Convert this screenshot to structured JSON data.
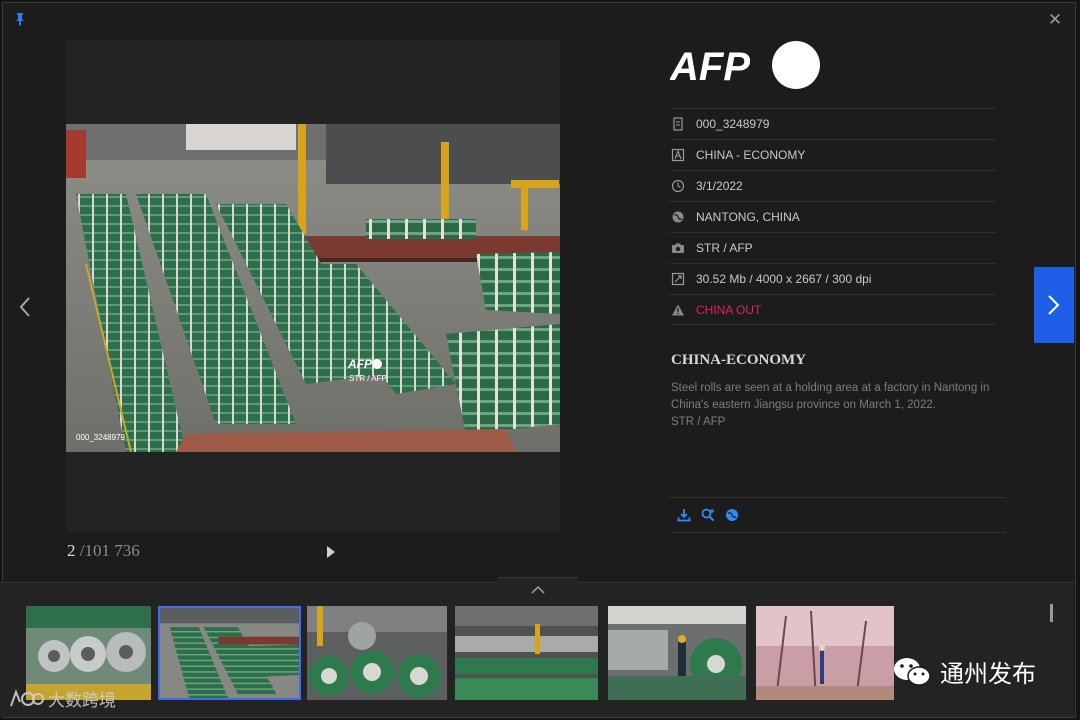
{
  "window": {
    "close_glyph": "✕"
  },
  "logo": {
    "text": "AFP"
  },
  "photo": {
    "id_label": "000_3248979",
    "wm_brand": "AFP",
    "wm_credit": "STR / AFP"
  },
  "counter": {
    "current": "2",
    "total": "/101 736"
  },
  "meta": {
    "rows": [
      {
        "icon": "document-icon",
        "text": "000_3248979"
      },
      {
        "icon": "category-icon",
        "text": "CHINA - ECONOMY"
      },
      {
        "icon": "clock-icon",
        "text": "3/1/2022"
      },
      {
        "icon": "globe-icon",
        "text": "NANTONG, CHINA"
      },
      {
        "icon": "camera-icon",
        "text": "STR / AFP"
      },
      {
        "icon": "resize-icon",
        "text": "30.52 Mb / 4000 x 2667 / 300 dpi"
      },
      {
        "icon": "warning-icon",
        "text": "CHINA OUT"
      }
    ]
  },
  "story": {
    "title": "CHINA-ECONOMY",
    "caption_1": "Steel rolls are seen at a holding area at a factory in Nantong in China's eastern Jiangsu province on March 1, 2022.",
    "caption_2": "STR / AFP"
  },
  "colors": {
    "accent": "#1f5fe8",
    "warning": "#e0245e",
    "selected_border": "#3d6df2"
  },
  "watermark": {
    "left_text": "大数跨境",
    "right_text": "通州发布"
  }
}
